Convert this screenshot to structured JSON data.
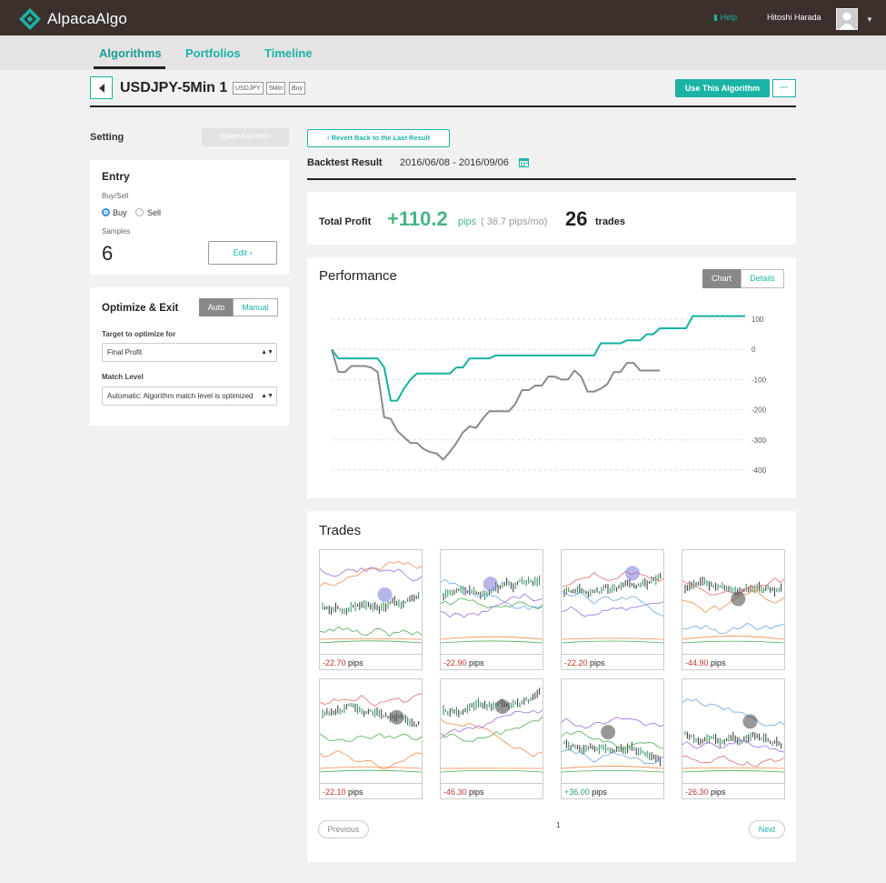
{
  "app": {
    "name": "AlpacaAlgo",
    "help_label": "Help",
    "user_name": "Hitoshi Harada",
    "accent": "#1ab3a6"
  },
  "nav": {
    "tabs": [
      {
        "label": "Algorithms",
        "active": true
      },
      {
        "label": "Portfolios",
        "active": false
      },
      {
        "label": "Timeline",
        "active": false
      }
    ]
  },
  "algorithm": {
    "title": "USDJPY-5Min 1",
    "tags": [
      "USDJPY",
      "5Min",
      "Buy"
    ],
    "use_button": "Use This Algorithm",
    "more_button": "···"
  },
  "setting": {
    "label": "Setting",
    "update_button": "Update Algorithm ›",
    "entry": {
      "title": "Entry",
      "buy_sell_label": "Buy/Sell",
      "options": [
        "Buy",
        "Sell"
      ],
      "selected": "Buy",
      "samples_label": "Samples",
      "samples_value": "6",
      "edit_button": "Edit ›"
    },
    "optimize": {
      "title": "Optimize & Exit",
      "modes": [
        "Auto",
        "Manual"
      ],
      "selected_mode": "Auto",
      "target_label": "Target to optimize for",
      "target_value": "Final Profit",
      "match_label": "Match Level",
      "match_value": "Automatic: Algorithm match level is optimized"
    }
  },
  "backtest": {
    "revert_button": "‹ Revert Back to the Last Result",
    "title": "Backtest Result",
    "date_range": "2016/06/08 - 2016/09/06",
    "total_profit_label": "Total Profit",
    "total_profit_value": "+110.2",
    "profit_unit": "pips",
    "profit_rate": "( 36.7 pips/mo)",
    "trades_count": "26",
    "trades_label": "trades"
  },
  "performance": {
    "title": "Performance",
    "toggles": [
      "Chart",
      "Details"
    ],
    "selected_toggle": "Chart",
    "chart_data": {
      "type": "line",
      "title": "Performance",
      "ylim": [
        -400,
        100
      ],
      "yticks": [
        100,
        0,
        -100,
        -200,
        -300,
        -400
      ],
      "grid": true,
      "series": [
        {
          "color": "#16b0a2",
          "values": [
            0,
            -30,
            -30,
            -30,
            -30,
            -30,
            -30,
            -30,
            -60,
            -170,
            -170,
            -130,
            -100,
            -80,
            -80,
            -80,
            -80,
            -80,
            -80,
            -60,
            -60,
            -30,
            -30,
            -30,
            -30,
            -20,
            -20,
            -20,
            -20,
            -20,
            -20,
            -20,
            -20,
            -20,
            -20,
            -20,
            -20,
            -20,
            -20,
            -20,
            -20,
            20,
            20,
            20,
            20,
            30,
            30,
            30,
            50,
            50,
            70,
            70,
            70,
            70,
            70,
            110,
            110,
            110,
            110,
            110,
            110,
            110,
            110,
            110
          ]
        },
        {
          "color": "#8a8a8a",
          "values": [
            0,
            -75,
            -75,
            -55,
            -55,
            -55,
            -60,
            -75,
            -225,
            -230,
            -270,
            -290,
            -310,
            -310,
            -330,
            -340,
            -345,
            -365,
            -340,
            -310,
            -275,
            -255,
            -260,
            -230,
            -205,
            -205,
            -205,
            -205,
            -180,
            -135,
            -135,
            -120,
            -120,
            -90,
            -90,
            -100,
            -100,
            -70,
            -90,
            -140,
            -140,
            -130,
            -115,
            -75,
            -75,
            -45,
            -45,
            -70,
            -70,
            -70,
            -70
          ]
        }
      ]
    }
  },
  "trades": {
    "title": "Trades",
    "unit": "pips",
    "items": [
      {
        "value": "-22.70",
        "positive": false
      },
      {
        "value": "-22.90",
        "positive": false
      },
      {
        "value": "-22.20",
        "positive": false
      },
      {
        "value": "-44.90",
        "positive": false
      },
      {
        "value": "-22.10",
        "positive": false
      },
      {
        "value": "-46.30",
        "positive": false
      },
      {
        "value": "+36.00",
        "positive": true
      },
      {
        "value": "-26.30",
        "positive": false
      }
    ],
    "pager": {
      "previous": "Previous",
      "page": "1",
      "next": "Next"
    }
  }
}
